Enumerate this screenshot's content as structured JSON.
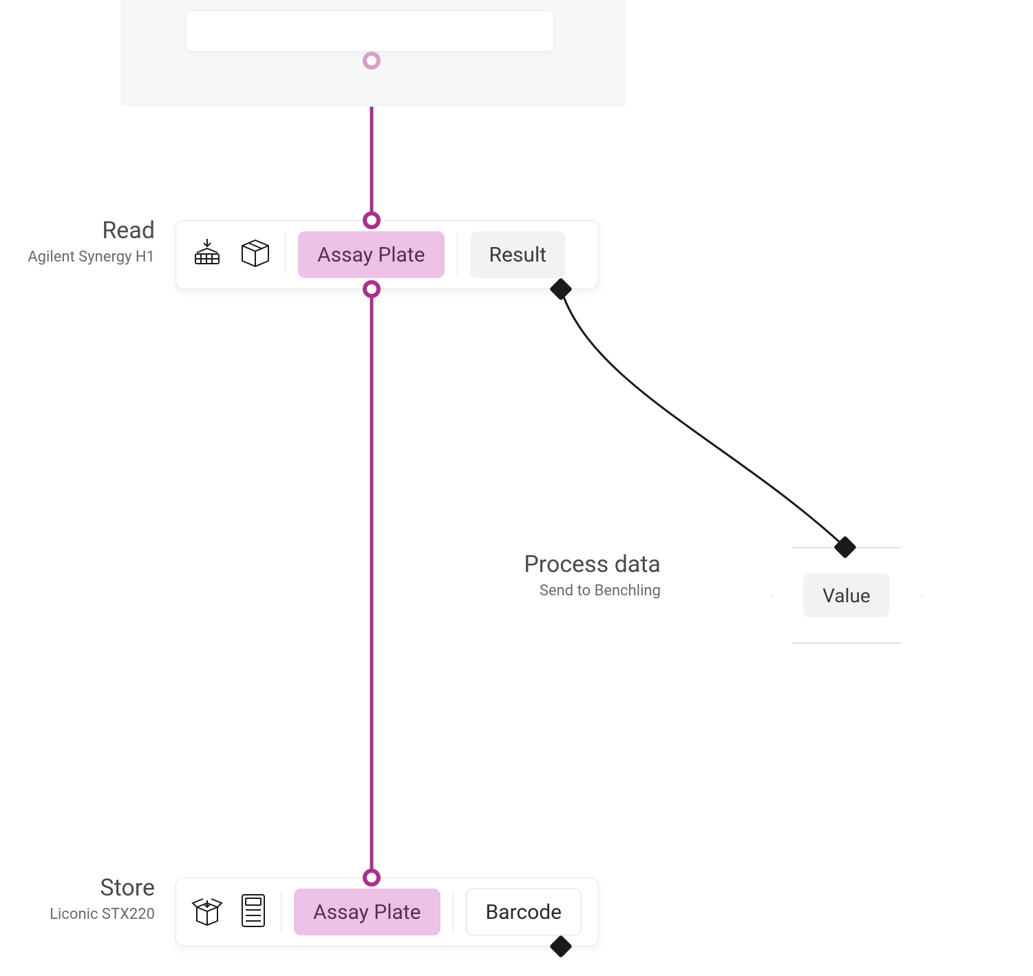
{
  "colors": {
    "accent": "#a9308b",
    "chip_pink": "#eec1e6",
    "chip_grey": "#f2f2f2"
  },
  "nodes": {
    "read": {
      "title": "Read",
      "subtitle": "Agilent Synergy H1",
      "chip_primary": "Assay Plate",
      "chip_secondary": "Result",
      "icon1": "reader-icon",
      "icon2": "package-icon"
    },
    "store": {
      "title": "Store",
      "subtitle": "Liconic STX220",
      "chip_primary": "Assay Plate",
      "chip_secondary": "Barcode",
      "icon1": "open-box-icon",
      "icon2": "storage-unit-icon"
    },
    "process": {
      "title": "Process data",
      "subtitle": "Send to Benchling",
      "chip": "Value"
    }
  }
}
